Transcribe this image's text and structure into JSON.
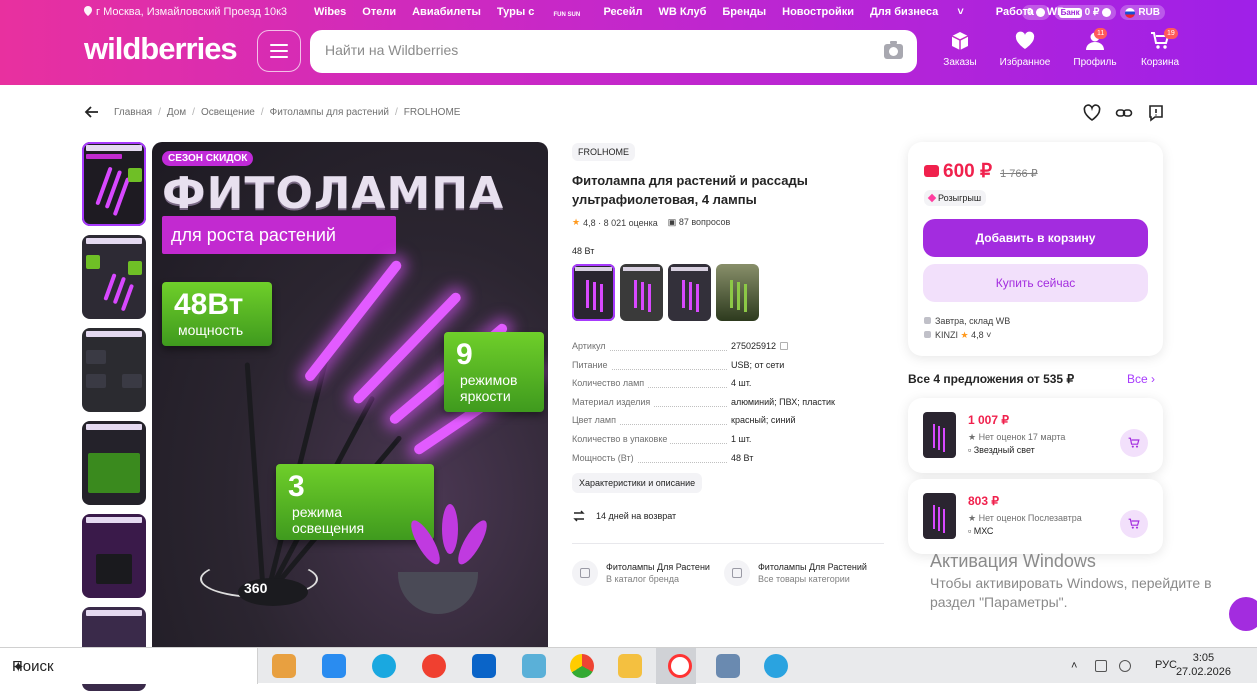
{
  "header": {
    "location": "г Москва, Измайловский Проезд 10к3",
    "nav": [
      "Wibes",
      "Отели",
      "Авиабилеты",
      "Туры с",
      "Ресейл",
      "WB Клуб",
      "Бренды",
      "Новостройки",
      "Для бизнеса",
      "Работа в WB"
    ],
    "tours_logo": "FUN SUN",
    "balance": "0",
    "bank_label": "Банк",
    "bank_balance": "0 ₽",
    "currency": "RUB",
    "logo": "wildberries",
    "search_placeholder": "Найти на Wildberries",
    "icons": [
      {
        "label": "Заказы",
        "badge": ""
      },
      {
        "label": "Избранное",
        "badge": ""
      },
      {
        "label": "Профиль",
        "badge": "11"
      },
      {
        "label": "Корзина",
        "badge": "19"
      }
    ]
  },
  "breadcrumb": [
    "Главная",
    "Дом",
    "Освещение",
    "Фитолампы для растений",
    "FROLHOME"
  ],
  "main_image": {
    "sezon": "СЕЗОН СКИДОК",
    "title": "ФИТОЛАМПА",
    "subtitle": "для роста растений",
    "power_big": "48Вт",
    "power_small": "мощность",
    "modes_big": "9",
    "modes_small1": "режимов",
    "modes_small2": "яркости",
    "light_big": "3",
    "light_small1": "режима",
    "light_small2": "освещения",
    "rotate": "360"
  },
  "thumbs": [
    {
      "title": "Фитолампа"
    },
    {
      "title": "Фитолампа"
    },
    {
      "title": "В КОМПЛЕКТЕ:"
    },
    {
      "title": "Мощность"
    },
    {
      "title": "ЛЕГКОЕ УПРАВЛЕНИЕ"
    },
    {
      "title": "Как настроить таймер?"
    }
  ],
  "product": {
    "brand": "FROLHOME",
    "name": "Фитолампа для растений и рассады ультрафиолетовая, 4 лампы",
    "rating": "4,8",
    "reviews": "8 021 оценка",
    "questions": "87 вопросов",
    "variant_label": "48 Вт",
    "specs": [
      {
        "k": "Артикул",
        "v": "275025912"
      },
      {
        "k": "Питание",
        "v": "USB; от сети"
      },
      {
        "k": "Количество ламп",
        "v": "4 шт."
      },
      {
        "k": "Материал изделия",
        "v": "алюминий; ПВХ; пластик"
      },
      {
        "k": "Цвет ламп",
        "v": "красный; синий"
      },
      {
        "k": "Количество в упаковке",
        "v": "1 шт."
      },
      {
        "k": "Мощность (Вт)",
        "v": "48 Вт"
      }
    ],
    "specs_button": "Характеристики и описание",
    "return": "14 дней на возврат",
    "cats": [
      {
        "t": "Фитолампы Для Растени",
        "s": "В каталог бренда"
      },
      {
        "t": "Фитолампы Для Растений",
        "s": "Все товары категории"
      }
    ]
  },
  "buy": {
    "price": "600 ₽",
    "old_price": "1 766 ₽",
    "giveaway": "Розыгрыш",
    "add": "Добавить в корзину",
    "buy_now": "Купить сейчас",
    "delivery": "Завтра, склад WB",
    "seller": "KINZI",
    "seller_rating": "4,8"
  },
  "offers": {
    "title": "Все 4 предложения от 535 ₽",
    "all": "Все",
    "items": [
      {
        "price": "1 007 ₽",
        "meta": "Нет оценок  17 марта",
        "seller": "Звездный свет"
      },
      {
        "price": "803 ₽",
        "meta": "Нет оценок  Послезавтра",
        "seller": "МХС"
      }
    ]
  },
  "windows": {
    "title": "Активация Windows",
    "text": "Чтобы активировать Windows, перейдите в раздел \"Параметры\"."
  },
  "taskbar": {
    "search": "Поиск",
    "lang": "РУС",
    "time": "3:05",
    "date": "27.02.2026"
  }
}
